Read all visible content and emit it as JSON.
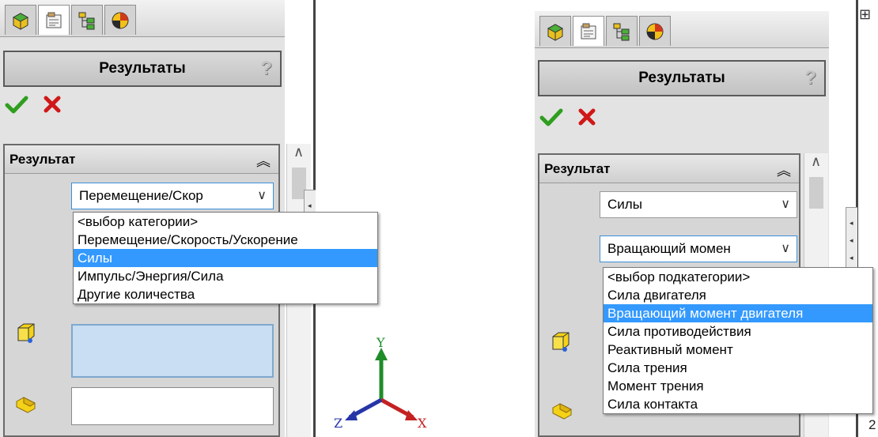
{
  "left": {
    "tabs": [
      "feature-manager-icon",
      "property-manager-icon",
      "configuration-manager-icon",
      "display-manager-icon"
    ],
    "title": "Результаты",
    "help": "?",
    "group_title": "Результат",
    "combo_value": "Перемещение/Скор",
    "dropdown_options": [
      "<выбор категории>",
      "Перемещение/Скорость/Ускорение",
      "Силы",
      "Импульс/Энергия/Сила",
      "Другие количества"
    ],
    "selected_option": "Силы"
  },
  "right": {
    "tabs": [
      "feature-manager-icon",
      "property-manager-icon",
      "configuration-manager-icon",
      "display-manager-icon"
    ],
    "title": "Результаты",
    "help": "?",
    "group_title": "Результат",
    "combo_category_value": "Силы",
    "combo_subcategory_value": "Вращающий момен",
    "dropdown_options": [
      "<выбор подкатегории>",
      "Сила двигателя",
      "Вращающий момент двигателя",
      "Сила противодействия",
      "Реактивный момент",
      "Сила трения",
      "Момент трения",
      "Сила контакта"
    ],
    "selected_option": "Вращающий момент двигателя",
    "tree_expander": "⊞",
    "edge_text": "2"
  },
  "triad": {
    "y": "Y",
    "x": "X",
    "z": "Z"
  },
  "colors": {
    "selection": "#3399ff",
    "ok_green": "#2e9e1e",
    "cancel_red": "#d01818",
    "face_yellow": "#f3d218",
    "triad_y": "#1f8c2a",
    "triad_x": "#c42222",
    "triad_z": "#2636a8"
  }
}
